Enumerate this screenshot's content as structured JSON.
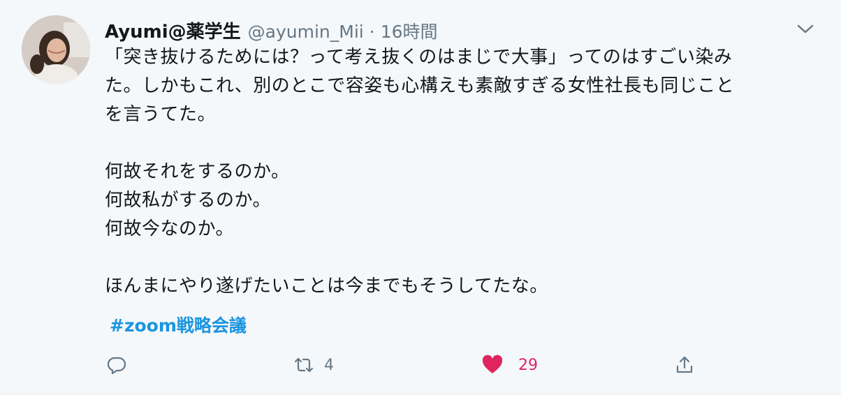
{
  "tweet": {
    "author_name": "Ayumi@薬学生",
    "handle": "@ayumin_Mii",
    "separator": "·",
    "time": "16時間",
    "body_lines": [
      "「突き抜けるためには？って考え抜くのはまじで大事」ってのはすごい染み",
      "た。しかもこれ、別のとこで容姿も心構えも素敵すぎる女性社長も同じこと",
      "を言うてた。",
      "",
      "何故それをするのか。",
      "何故私がするのか。",
      "何故今なのか。",
      "",
      "ほんまにやり遂げたいことは今までもそうしてたな。"
    ],
    "hashtag": "#zoom戦略会議"
  },
  "actions": {
    "reply_icon": "reply-icon",
    "retweet_icon": "retweet-icon",
    "retweet_count": "4",
    "like_icon": "heart-icon",
    "like_count": "29",
    "share_icon": "share-icon"
  },
  "colors": {
    "background": "#f5f8fa",
    "text": "#14171a",
    "muted": "#657786",
    "link": "#1b95e0",
    "like": "#e0245e"
  }
}
